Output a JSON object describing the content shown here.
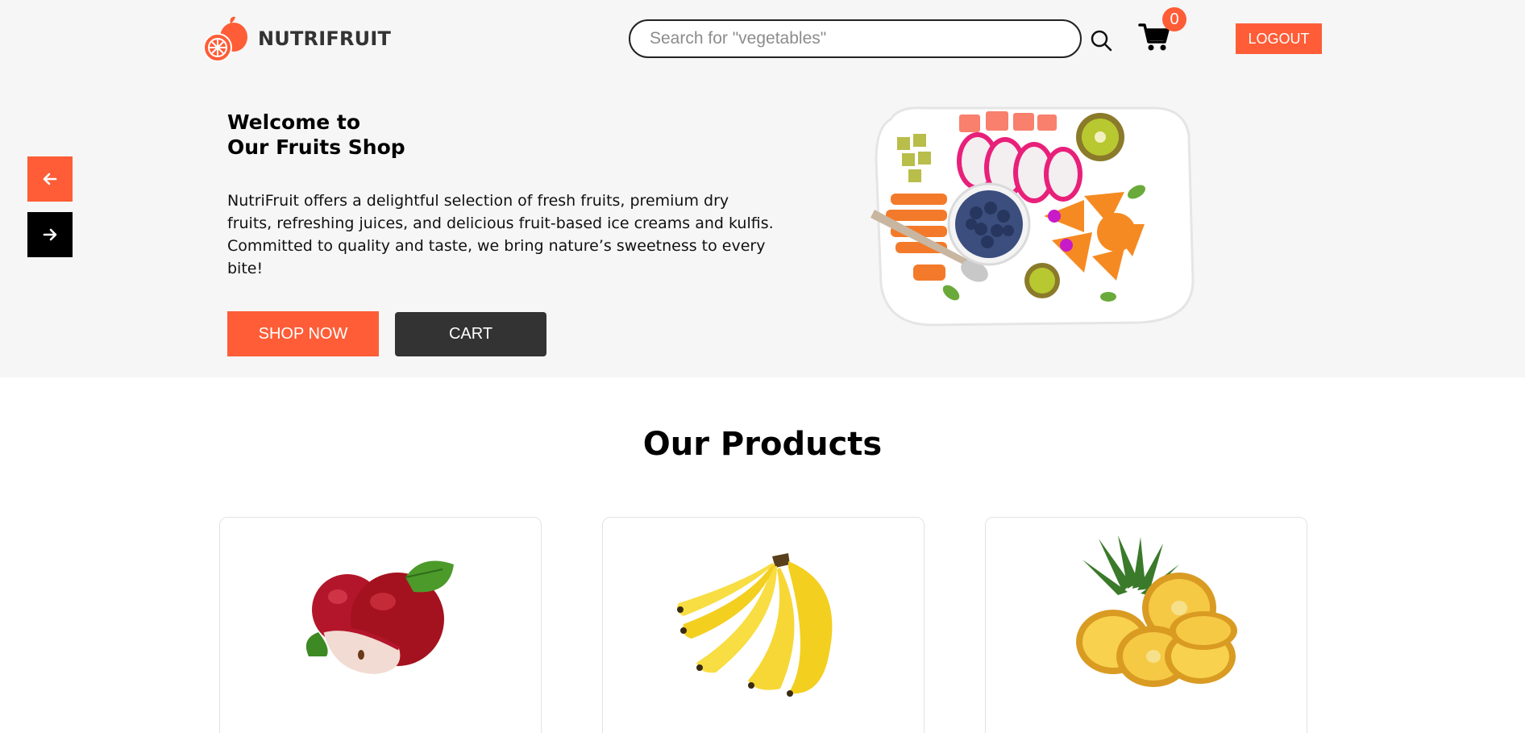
{
  "header": {
    "brand": "NUTRIFRUIT",
    "search_placeholder": "Search for \"vegetables\"",
    "cart_count": "0",
    "logout_label": "LOGOUT"
  },
  "hero": {
    "title_line1": "Welcome to",
    "title_line2": "Our Fruits Shop",
    "description": "NutriFruit offers a delightful selection of fresh fruits, premium dry fruits, refreshing juices, and delicious fruit-based ice creams and kulfis. Committed to quality and taste, we bring nature’s sweetness to every bite!",
    "shop_now_label": "SHOP NOW",
    "cart_label": "CART"
  },
  "products": {
    "title": "Our Products",
    "items": [
      {
        "icon": "apple-image"
      },
      {
        "icon": "banana-image"
      },
      {
        "icon": "pineapple-image"
      }
    ]
  },
  "colors": {
    "accent": "#fe5d37",
    "dark": "#333333",
    "hero_bg": "#f6f6f6"
  }
}
